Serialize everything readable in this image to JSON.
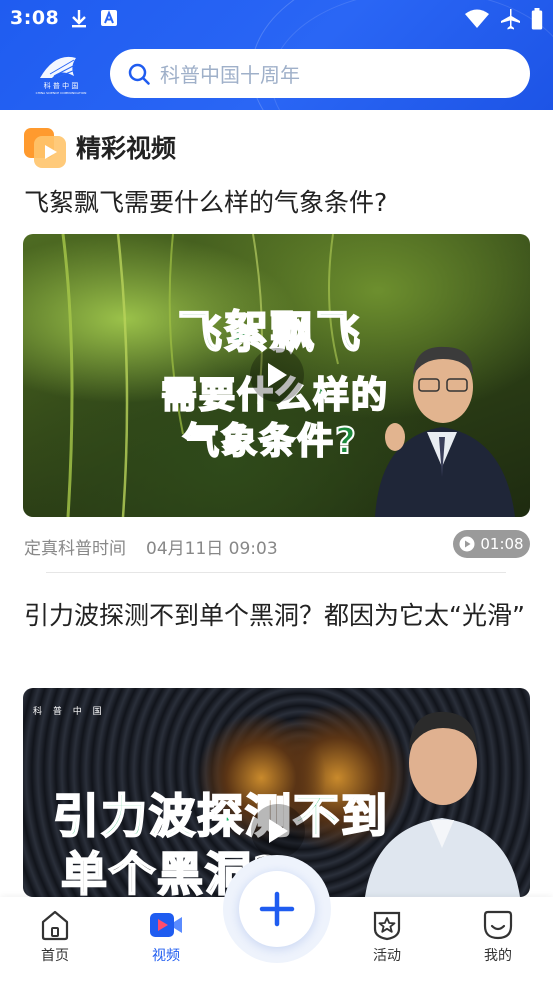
{
  "status_bar": {
    "time": "3:08"
  },
  "header": {
    "logo_text": "科 普 中 国",
    "logo_subtext": "CHINA SCIENCE COMMUNICATION",
    "search_placeholder": "科普中国十周年"
  },
  "section": {
    "title": "精彩视频"
  },
  "videos": [
    {
      "title": "飞絮飘飞需要什么样的气象条件?",
      "thumb_text_line1": "飞絮飘飞",
      "thumb_text_line2": "需要什么样的",
      "thumb_text_line3": "气象条件?",
      "source": "定真科普时间",
      "date": "04月11日 09:03",
      "duration": "01:08"
    },
    {
      "title": "引力波探测不到单个黑洞？都因为它太“光滑”",
      "thumb_logo": "科 普 中 国",
      "thumb_text_line1": "引力波探测不到",
      "thumb_text_line2": "单个黑洞?"
    }
  ],
  "bottom_nav": {
    "items": [
      {
        "label": "首页",
        "icon": "home-icon"
      },
      {
        "label": "视频",
        "icon": "video-icon",
        "active": true
      },
      {
        "label": "活动",
        "icon": "star-badge-icon"
      },
      {
        "label": "我的",
        "icon": "smile-icon"
      }
    ],
    "fab_icon": "plus-icon"
  },
  "colors": {
    "primary": "#1f5cf0",
    "muted": "#888888",
    "duration_badge": "#9a9a9a"
  }
}
